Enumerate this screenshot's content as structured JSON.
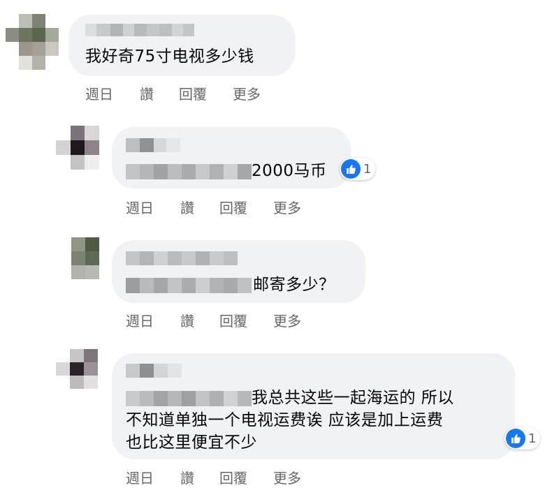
{
  "actions": {
    "time": "週日",
    "like": "讚",
    "reply": "回覆",
    "more": "更多"
  },
  "comments": [
    {
      "text": "我好奇75寸电视多少钱"
    },
    {
      "text": "2000马币",
      "reactions": "1"
    },
    {
      "text": "邮寄多少？"
    },
    {
      "lines": [
        "我总共这些一起海运的 所以",
        "不知道单独一个电视运费诶 应该是加上运费",
        "也比这里便宜不少"
      ],
      "reactions": "1"
    }
  ],
  "colors": {
    "bubble": "#f0f2f5",
    "meta": "#65676b",
    "like_blue": "#1877f2"
  },
  "icons": [
    "like-icon"
  ]
}
